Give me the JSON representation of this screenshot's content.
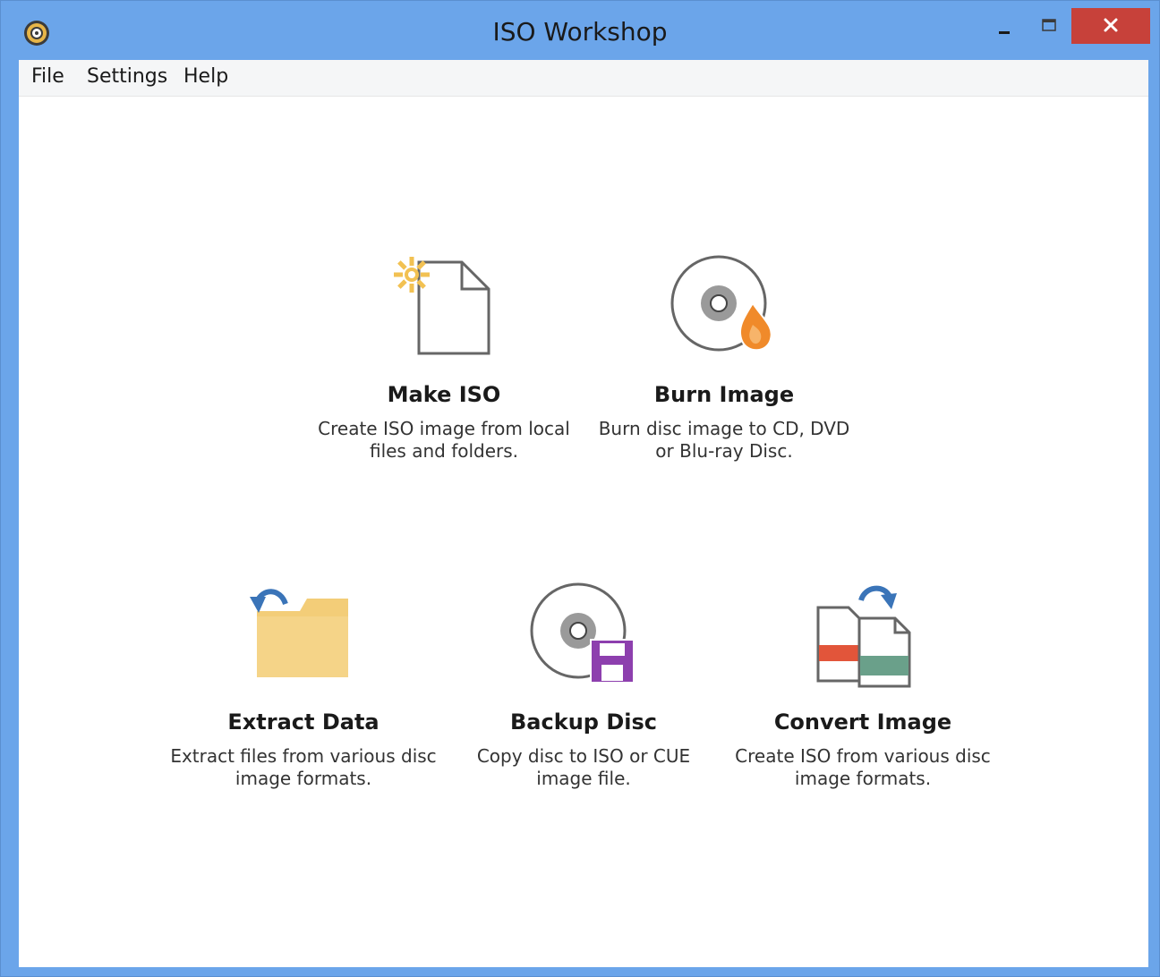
{
  "window": {
    "title": "ISO Workshop",
    "icon": "disc-app-icon",
    "controls": {
      "minimize": "minimize-icon",
      "maximize": "maximize-icon",
      "close": "close-icon"
    }
  },
  "menu": {
    "items": [
      {
        "label": "File"
      },
      {
        "label": "Settings"
      },
      {
        "label": "Help"
      }
    ]
  },
  "tiles": [
    {
      "title": "Make ISO",
      "desc": "Create ISO image from local\nfiles and folders.",
      "icon": "new-file-icon"
    },
    {
      "title": "Burn Image",
      "desc": "Burn disc image to CD, DVD\nor Blu-ray Disc.",
      "icon": "burn-disc-icon"
    },
    {
      "title": "Extract Data",
      "desc": "Extract files from various disc\nimage formats.",
      "icon": "extract-folder-icon"
    },
    {
      "title": "Backup Disc",
      "desc": "Copy disc to ISO or CUE\nimage file.",
      "icon": "backup-disc-icon"
    },
    {
      "title": "Convert Image",
      "desc": "Create ISO from various disc\nimage formats.",
      "icon": "convert-files-icon"
    }
  ],
  "colors": {
    "titlebar": "#6ba5ea",
    "close": "#c7413a",
    "folder": "#f3cd78",
    "flame": "#f08a2a",
    "floppy": "#8d3fae",
    "convert_red": "#e2553a",
    "convert_green": "#6aa08a",
    "arrow_blue": "#3a74b8"
  }
}
